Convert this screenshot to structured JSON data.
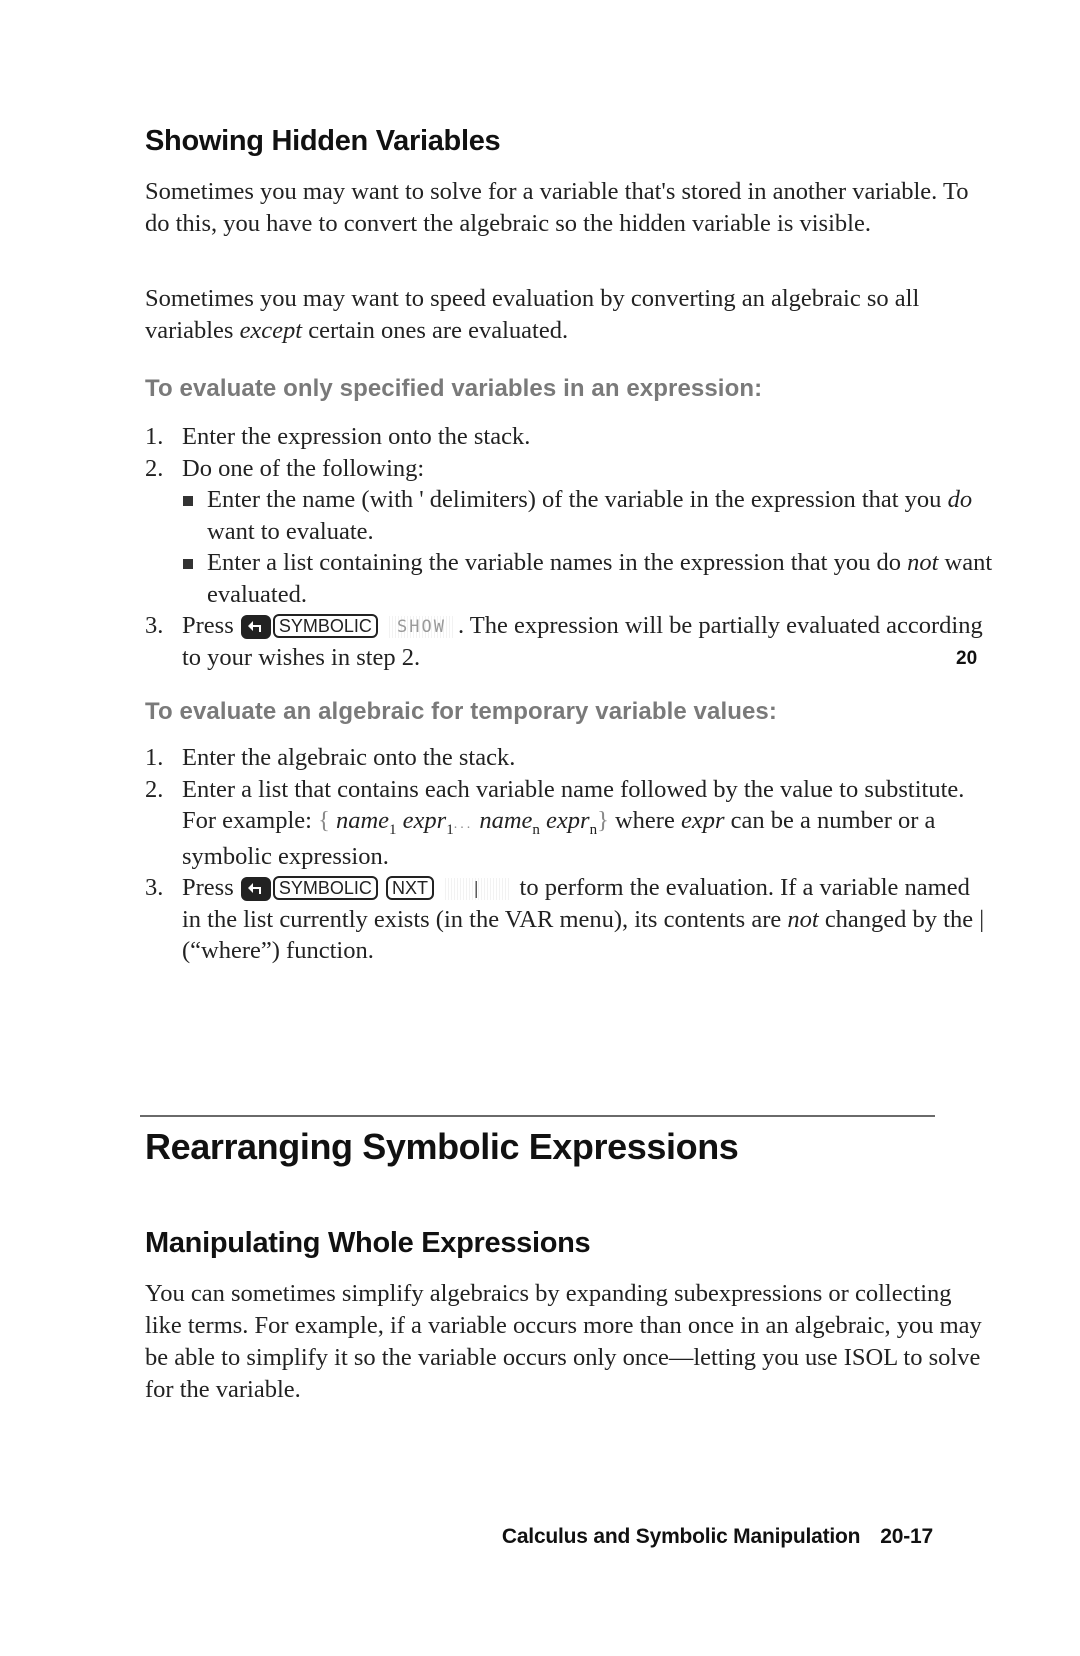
{
  "section_showing_hidden": {
    "heading": "Showing Hidden Variables",
    "para1": "Sometimes you may want to solve for a variable that's stored in another variable. To do this, you have to convert the algebraic so the hidden variable is visible.",
    "para2_before": "Sometimes you may want to speed evaluation by converting an algebraic so all variables ",
    "para2_em": "except",
    "para2_after": " certain ones are evaluated."
  },
  "procedure_specified": {
    "heading": "To evaluate only specified variables in an expression:",
    "steps": [
      {
        "num": "1.",
        "text": "Enter the expression onto the stack."
      },
      {
        "num": "2.",
        "text": "Do one of the following:",
        "bullets": [
          {
            "before": "Enter the name (with ' delimiters) of the variable in the expression that you ",
            "em": "do",
            "after": " want to evaluate."
          },
          {
            "before": "Enter a list containing the variable names in the expression that you do ",
            "em": "not",
            "after": " want evaluated."
          }
        ]
      },
      {
        "num": "3.",
        "press": "Press",
        "keys": [
          "SYMBOLIC"
        ],
        "shift_key_icon": "left-shift-arrow",
        "softkey": "SHOW",
        "after": ". The expression will be partially evaluated according to your wishes in step 2."
      }
    ]
  },
  "procedure_temporary": {
    "heading": "To evaluate an algebraic for temporary variable values:",
    "steps": [
      {
        "num": "1.",
        "text": "Enter the algebraic onto the stack."
      },
      {
        "num": "2.",
        "before": "Enter a list that contains each variable name followed by the value to substitute. For example: ",
        "example": {
          "open_brace": "{",
          "name1": "name",
          "sub1": "1",
          "expr1": "expr",
          "esub1": "1",
          "ellipsis": "...",
          "namen": "name",
          "subn": "n",
          "exprn": "expr",
          "esubn": "n",
          "close_brace": "}"
        },
        "mid": " where ",
        "em": "expr",
        "after": " can be a number or a symbolic expression."
      },
      {
        "num": "3.",
        "press": "Press",
        "keys": [
          "SYMBOLIC",
          "NXT"
        ],
        "shift_key_icon": "left-shift-arrow",
        "softkey": "|",
        "after_before_em": " to perform the evaluation. If a variable named in the list currently exists (in the VAR menu), its contents are ",
        "em": "not",
        "after": " changed by the | (“where”) function."
      }
    ]
  },
  "section_rearranging": {
    "heading": "Rearranging Symbolic Expressions"
  },
  "section_manipulating": {
    "heading": "Manipulating Whole Expressions",
    "para": "You can sometimes simplify algebraics by expanding subexpressions or collecting like terms. For example, if a variable occurs more than once in an algebraic, you may be able to simplify it so the variable occurs only once—letting you use ISOL to solve for the variable."
  },
  "thumb_tab": "20",
  "footer": {
    "chapter_title": "Calculus and Symbolic Manipulation",
    "page_number": "20-17"
  }
}
